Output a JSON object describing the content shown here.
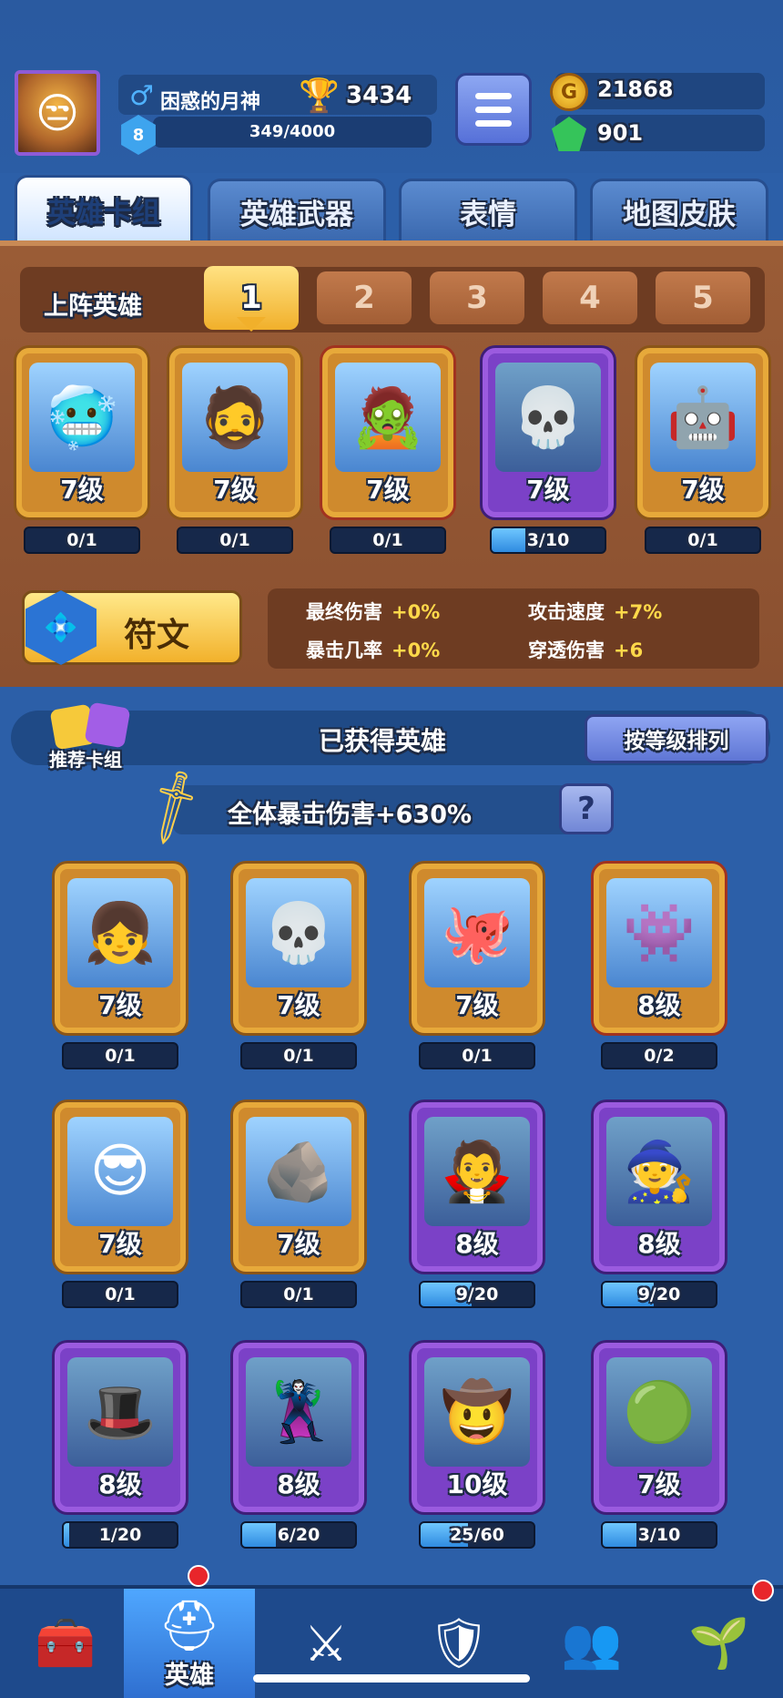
{
  "player": {
    "name": "困惑的月神",
    "trophies": "3434",
    "level": "8",
    "exp": "349/4000",
    "exp_fraction": 0.087,
    "gold": "21868",
    "gems": "901"
  },
  "tabs": [
    {
      "label": "英雄卡组",
      "active": true
    },
    {
      "label": "英雄武器",
      "active": false
    },
    {
      "label": "表情",
      "active": false
    },
    {
      "label": "地图皮肤",
      "active": false
    }
  ],
  "deck": {
    "label": "上阵英雄",
    "slots": [
      "1",
      "2",
      "3",
      "4",
      "5"
    ],
    "active_slot": "1",
    "heroes": [
      {
        "level": "7级",
        "progress": "0/1",
        "fill": 0,
        "rarity": "gold",
        "emoji": "🥶"
      },
      {
        "level": "7级",
        "progress": "0/1",
        "fill": 0,
        "rarity": "gold",
        "emoji": "🧔"
      },
      {
        "level": "7级",
        "progress": "0/1",
        "fill": 0,
        "rarity": "gold-red",
        "emoji": "🧟"
      },
      {
        "level": "7级",
        "progress": "3/10",
        "fill": 0.3,
        "rarity": "purple",
        "emoji": "💀"
      },
      {
        "level": "7级",
        "progress": "0/1",
        "fill": 0,
        "rarity": "gold",
        "emoji": "🤖"
      }
    ]
  },
  "rune": {
    "label": "符文"
  },
  "stats": [
    {
      "name": "最终伤害",
      "value": "+0%"
    },
    {
      "name": "攻击速度",
      "value": "+7%"
    },
    {
      "name": "暴击几率",
      "value": "+0%"
    },
    {
      "name": "穿透伤害",
      "value": "+6"
    }
  ],
  "obtained": {
    "recommend_label": "推荐卡组",
    "title": "已获得英雄",
    "sort_label": "按等级排列",
    "crit_bonus": "全体暴击伤害+630%",
    "help": "?"
  },
  "heroes": [
    {
      "level": "7级",
      "progress": "0/1",
      "fill": 0,
      "rarity": "gold",
      "emoji": "👧"
    },
    {
      "level": "7级",
      "progress": "0/1",
      "fill": 0,
      "rarity": "gold",
      "emoji": "💀"
    },
    {
      "level": "7级",
      "progress": "0/1",
      "fill": 0,
      "rarity": "gold",
      "emoji": "🐙"
    },
    {
      "level": "8级",
      "progress": "0/2",
      "fill": 0,
      "rarity": "gold-red",
      "emoji": "👾"
    },
    {
      "level": "7级",
      "progress": "0/1",
      "fill": 0,
      "rarity": "gold",
      "emoji": "😎"
    },
    {
      "level": "7级",
      "progress": "0/1",
      "fill": 0,
      "rarity": "gold",
      "emoji": "🪨"
    },
    {
      "level": "8级",
      "progress": "9/20",
      "fill": 0.45,
      "rarity": "purple",
      "emoji": "🧛"
    },
    {
      "level": "8级",
      "progress": "9/20",
      "fill": 0.45,
      "rarity": "purple",
      "emoji": "🧙"
    },
    {
      "level": "8级",
      "progress": "1/20",
      "fill": 0.05,
      "rarity": "purple",
      "emoji": "🎩"
    },
    {
      "level": "8级",
      "progress": "6/20",
      "fill": 0.3,
      "rarity": "purple",
      "emoji": "🦹"
    },
    {
      "level": "10级",
      "progress": "25/60",
      "fill": 0.42,
      "rarity": "purple",
      "emoji": "🤠"
    },
    {
      "level": "7级",
      "progress": "3/10",
      "fill": 0.3,
      "rarity": "purple",
      "emoji": "🟢"
    }
  ],
  "nav": [
    {
      "icon": "treasure-chest-icon",
      "glyph": "🧰",
      "label": ""
    },
    {
      "icon": "knight-helmet-icon",
      "glyph": "⛑",
      "label": "英雄",
      "active": true
    },
    {
      "icon": "crossed-swords-icon",
      "glyph": "⚔",
      "label": ""
    },
    {
      "icon": "crown-shield-icon",
      "glyph": "🛡",
      "label": ""
    },
    {
      "icon": "team-banner-icon",
      "glyph": "👥",
      "label": ""
    },
    {
      "icon": "sprout-island-icon",
      "glyph": "🌱",
      "label": ""
    }
  ]
}
